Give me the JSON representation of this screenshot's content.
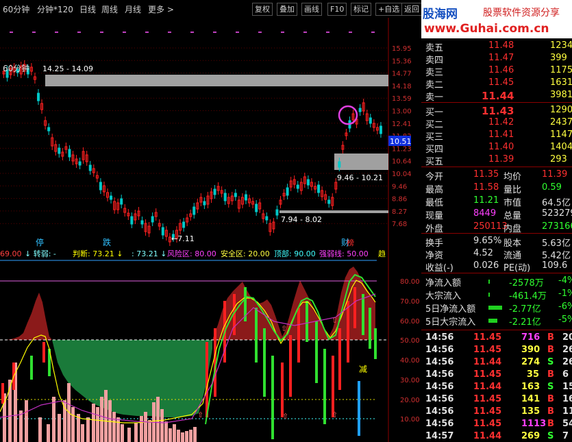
{
  "toolbar": {
    "tabs": [
      "60分钟",
      "分钟*120",
      "日线",
      "周线",
      "月线",
      "更多 >"
    ],
    "buttons": [
      "复权",
      "叠加",
      "画线",
      "F10",
      "标记",
      "+自选",
      "返回"
    ]
  },
  "logo": {
    "name": "股海网",
    "slogan": "股票软件资源分享",
    "url": "www.Guhai.com.cn"
  },
  "main_chart": {
    "period_label": "60分钟",
    "price_axis": [
      "15.95",
      "15.36",
      "14.77",
      "14.18",
      "13.59",
      "13.00",
      "12.41",
      "11.82",
      "11.23",
      "10.64",
      "10.04",
      "9.46",
      "8.86",
      "8.27",
      "7.68"
    ],
    "current_price_tag": "10.51",
    "annotations": {
      "range_high": "14.25 - 14.09",
      "range_mid": "9.46 - 10.21",
      "range_low": "7.94 - 8.02",
      "low_mark": "←7.11"
    },
    "bottom_tags": [
      "停",
      "跌",
      "财"
    ],
    "colors": {
      "up": "#ff2020",
      "down": "#00c8c8",
      "zone": "#a0a0a0",
      "circle": "#e040e0"
    }
  },
  "indicator": {
    "header": [
      {
        "text": "69.00",
        "color": "#ff4040"
      },
      {
        "text": "↓ 转弱: -",
        "color": "#80ffff"
      },
      {
        "text": "判断: 73.21 ↓",
        "color": "#ffff00"
      },
      {
        "text": ": 73.21 ↓",
        "color": "#80ffff"
      },
      {
        "text": "风险区: 80.00",
        "color": "#ff40ff"
      },
      {
        "text": "安全区: 20.00",
        "color": "#ffff40"
      },
      {
        "text": "顶部: 90.00",
        "color": "#40ffff"
      },
      {
        "text": "强弱线: 50.00",
        "color": "#ff40ff"
      },
      {
        "text": "趋",
        "color": "#ffff00"
      }
    ],
    "axis": [
      "80.00",
      "70.00",
      "60.00",
      "50.00",
      "40.00",
      "30.00",
      "20.00",
      "10.00"
    ],
    "signal_text": "减"
  },
  "orderbook": {
    "asks": [
      {
        "label": "卖五",
        "price": "11.48",
        "vol": "1234"
      },
      {
        "label": "卖四",
        "price": "11.47",
        "vol": "399"
      },
      {
        "label": "卖三",
        "price": "11.46",
        "vol": "1175"
      },
      {
        "label": "卖二",
        "price": "11.45",
        "vol": "1631"
      },
      {
        "label": "卖一",
        "price": "11.44",
        "vol": "3981"
      }
    ],
    "bids": [
      {
        "label": "买一",
        "price": "11.43",
        "vol": "1290"
      },
      {
        "label": "买二",
        "price": "11.42",
        "vol": "2437"
      },
      {
        "label": "买三",
        "price": "11.41",
        "vol": "1147"
      },
      {
        "label": "买四",
        "price": "11.40",
        "vol": "1404"
      },
      {
        "label": "买五",
        "price": "11.39",
        "vol": "293"
      }
    ]
  },
  "quote": [
    {
      "l1": "今开",
      "v1": "11.35",
      "c1": "#ff3030",
      "l2": "均价",
      "v2": "11.39",
      "c2": "#ff3030"
    },
    {
      "l1": "最高",
      "v1": "11.58",
      "c1": "#ff3030",
      "l2": "量比",
      "v2": "0.59",
      "c2": "#30ff30"
    },
    {
      "l1": "最低",
      "v1": "11.21",
      "c1": "#30ff30",
      "l2": "市值",
      "v2": "64.5亿",
      "c2": "#e0e0e0"
    },
    {
      "l1": "现量",
      "v1": "8449",
      "c1": "#ff40ff",
      "l2": "总量",
      "v2": "523279",
      "c2": "#e0e0e0"
    },
    {
      "l1": "外盘",
      "v1": "250113",
      "c1": "#ff3030",
      "l2": "内盘",
      "v2": "273166",
      "c2": "#30ff30"
    }
  ],
  "stats": [
    {
      "l1": "换手",
      "v1": "9.65%",
      "l2": "股本",
      "v2": "5.63亿"
    },
    {
      "l1": "净资",
      "v1": "4.52",
      "l2": "流通",
      "v2": "5.42亿"
    },
    {
      "l1": "收益(-)",
      "v1": "0.026",
      "l2": "PE(动)",
      "v2": "109.6"
    }
  ],
  "flows": [
    {
      "label": "净流入额",
      "value": "-2578万",
      "pct": "-4%",
      "bar": 0.02
    },
    {
      "label": "大宗流入",
      "value": "-461.4万",
      "pct": "-1%",
      "bar": 0.02
    },
    {
      "label": "5日净流入额",
      "value": "-2.77亿",
      "pct": "-6%",
      "bar": 0.9
    },
    {
      "label": "5日大宗流入",
      "value": "-2.21亿",
      "pct": "-5%",
      "bar": 0.6
    }
  ],
  "ticks": [
    {
      "time": "14:56",
      "price": "11.45",
      "vol": "716",
      "side": "B",
      "n": "20"
    },
    {
      "time": "14:56",
      "price": "11.45",
      "vol": "390",
      "side": "B",
      "n": "26"
    },
    {
      "time": "14:56",
      "price": "11.44",
      "vol": "274",
      "side": "S",
      "n": "26"
    },
    {
      "time": "14:56",
      "price": "11.45",
      "vol": "35",
      "side": "B",
      "n": "6"
    },
    {
      "time": "14:56",
      "price": "11.44",
      "vol": "163",
      "side": "S",
      "n": "15"
    },
    {
      "time": "14:56",
      "price": "11.45",
      "vol": "141",
      "side": "B",
      "n": "16"
    },
    {
      "time": "14:56",
      "price": "11.45",
      "vol": "135",
      "side": "B",
      "n": "11"
    },
    {
      "time": "14:56",
      "price": "11.45",
      "vol": "1113",
      "side": "B",
      "n": "54"
    },
    {
      "time": "14:57",
      "price": "11.44",
      "vol": "269",
      "side": "S",
      "n": "7"
    }
  ]
}
